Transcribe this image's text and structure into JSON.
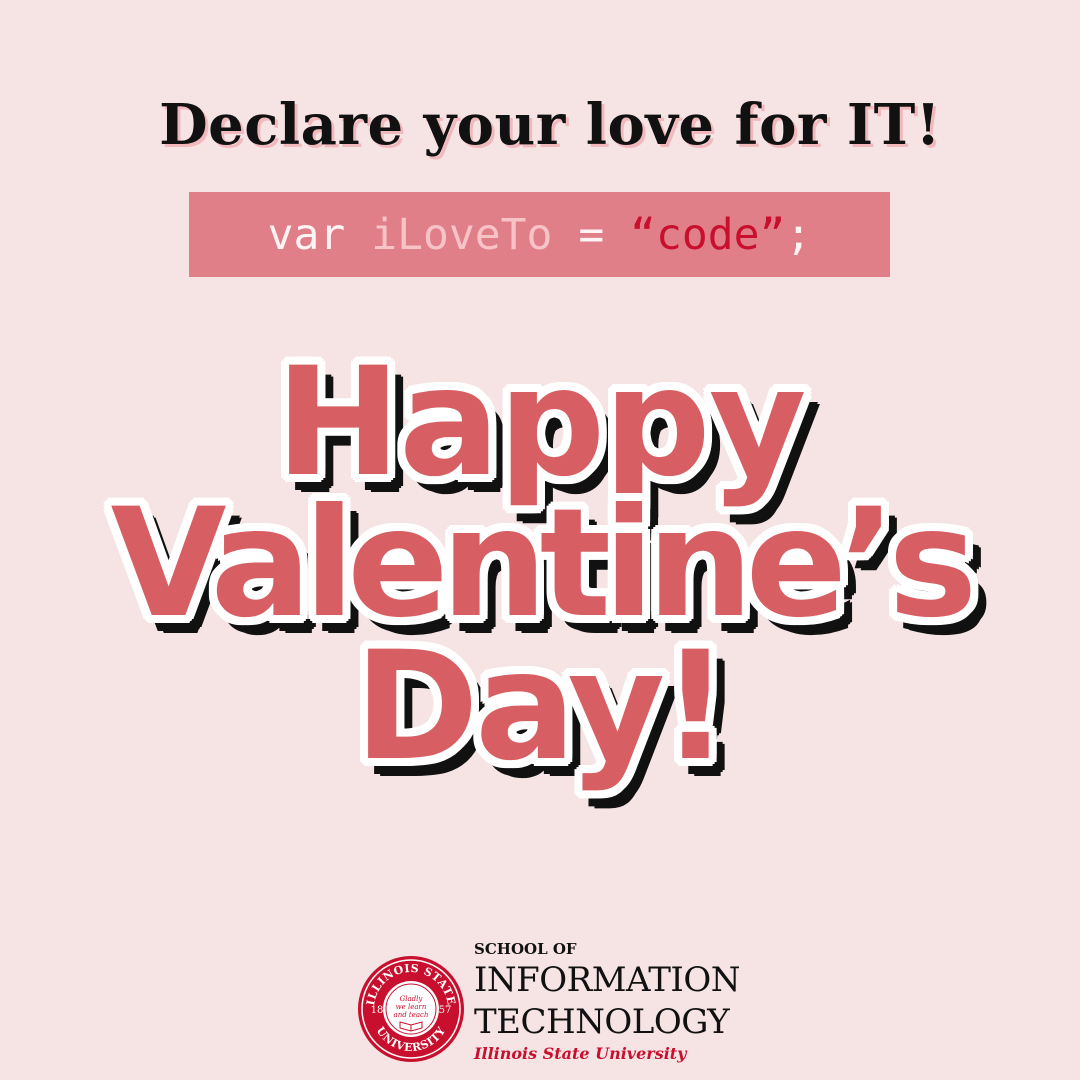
{
  "headline": "Declare your love for IT!",
  "code": {
    "keyword": "var",
    "identifier": "iLoveTo",
    "operator": "=",
    "string": "“code”",
    "terminator": ";"
  },
  "greeting": {
    "line1": "Happy",
    "line2": "Valentine’s",
    "line3": "Day!"
  },
  "logo": {
    "school_of": "SCHOOL OF",
    "line1": "INFORMATION",
    "line2": "TECHNOLOGY",
    "university": "Illinois State University",
    "seal": {
      "ring_top": "ILLINOIS STATE",
      "ring_bottom": "UNIVERSITY",
      "motto_1": "Gladly",
      "motto_2": "we learn",
      "motto_3": "and teach",
      "year_left": "18",
      "year_right": "57"
    }
  },
  "colors": {
    "background": "#f6e3e4",
    "code_box": "#e17f89",
    "greeting": "#d75f63",
    "brand_red": "#c8102e"
  }
}
